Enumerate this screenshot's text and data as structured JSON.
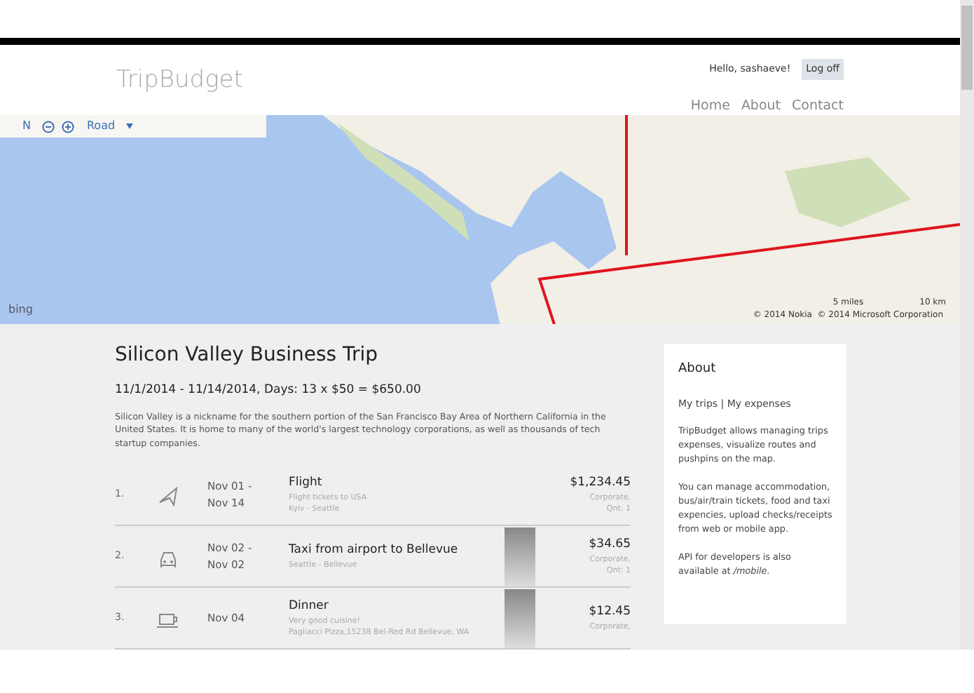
{
  "header": {
    "brand": "TripBudget",
    "greeting": "Hello, ",
    "username": "sashaeve",
    "greeting_end": "!",
    "logoff": "Log off",
    "nav": [
      {
        "label": "Home"
      },
      {
        "label": "About"
      },
      {
        "label": "Contact"
      }
    ]
  },
  "map": {
    "compass": "N",
    "view": "Road",
    "bing": "bing",
    "scale_miles": "5 miles",
    "scale_km": "10 km",
    "attribution": "© 2014 Nokia  © 2014 Microsoft Corporation"
  },
  "trip": {
    "title": "Silicon Valley Business Trip",
    "summary": "11/1/2014 - 11/14/2014, Days: 13 x $50 = $650.00",
    "description": "Silicon Valley is a nickname for the southern portion of the San Francisco Bay Area of Northern California in the United States. It is home to many of the world's largest technology corporations, as well as thousands of tech startup companies."
  },
  "expenses": [
    {
      "number": "1.",
      "kind": "plane",
      "dates": [
        "Nov 01 -",
        "Nov 14"
      ],
      "title": "Flight",
      "details": [
        "Flight tickets to USA",
        "Kyiv - Seattle"
      ],
      "photo": false,
      "amount": "$1,234.45",
      "meta": [
        "Corporate,",
        "Qnt: 1"
      ]
    },
    {
      "number": "2.",
      "kind": "car",
      "dates": [
        "Nov 02 -",
        "Nov 02"
      ],
      "title": "Taxi from airport to Bellevue",
      "details": [
        "Seattle - Bellevue"
      ],
      "photo": true,
      "amount": "$34.65",
      "meta": [
        "Corporate,",
        "Qnt: 1"
      ]
    },
    {
      "number": "3.",
      "kind": "cup",
      "dates": [
        "Nov 04"
      ],
      "title": "Dinner",
      "details": [
        "Very good cuisine!",
        "Pagliacci Pizza,15238 Bel-Red Rd Bellevue, WA"
      ],
      "photo": true,
      "amount": "$12.45",
      "meta": [
        "Corporate,"
      ]
    }
  ],
  "sidebar": {
    "title": "About",
    "links": [
      "My trips",
      "My expenses"
    ],
    "separator": "|",
    "paragraphs": [
      "TripBudget allows managing trips expenses, visualize routes and pushpins on the map.",
      "You can manage accommodation, bus/air/train tickets, food and taxi expencies, upload checks/receipts from web or mobile app.",
      "API for developers is also available at */mobile*."
    ]
  }
}
